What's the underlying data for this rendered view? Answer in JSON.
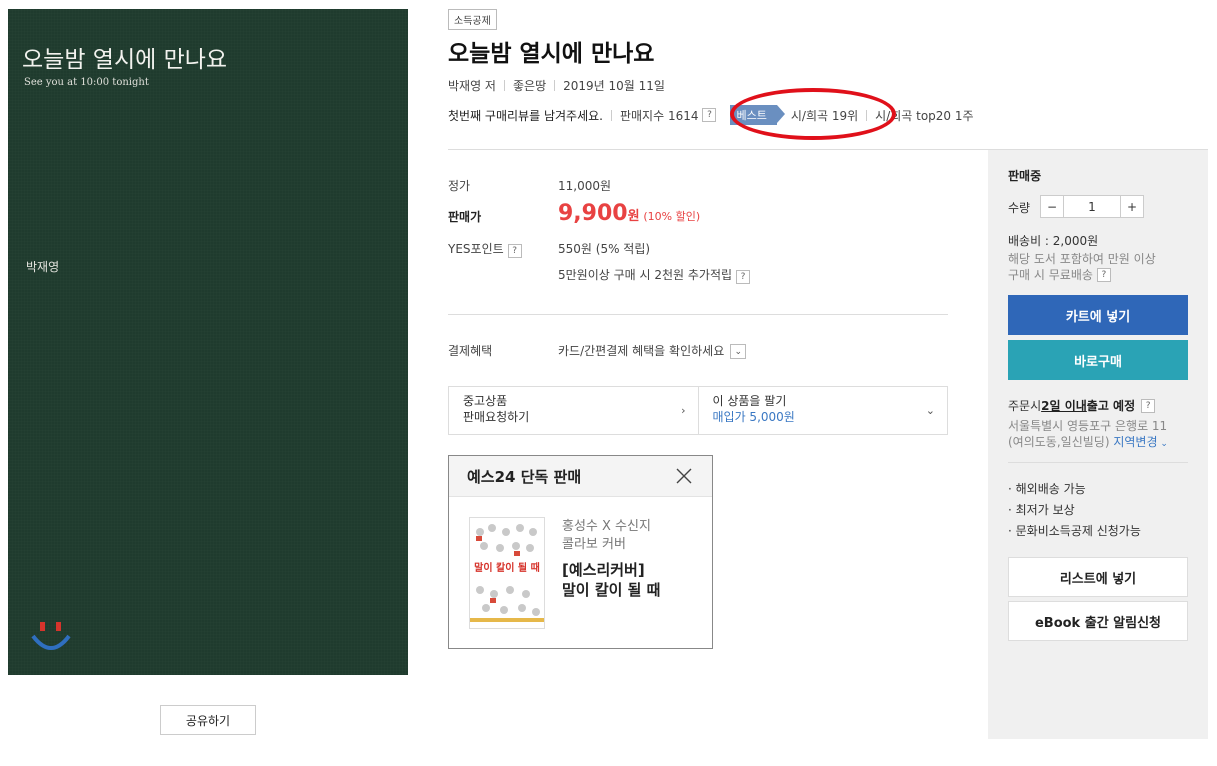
{
  "cover": {
    "title": "오늘밤 열시에 만나요",
    "subtitle": "See you at 10:00 tonight",
    "author": "박재영"
  },
  "share_label": "공유하기",
  "product": {
    "tag": "소득공제",
    "title": "오늘밤 열시에 만나요",
    "author": "박재영 저",
    "publisher": "좋은땅",
    "date": "2019년 10월 11일",
    "review_prompt": "첫번째 구매리뷰를 남겨주세요.",
    "sales_index": "판매지수 1614",
    "best_label": "베스트",
    "rank1": "시/희곡 19위",
    "rank2": "시/희곡 top20 1주"
  },
  "price": {
    "list_label": "정가",
    "list_value": "11,000원",
    "sale_label": "판매가",
    "sale_amount": "9,900",
    "sale_unit": "원",
    "discount": "(10% 할인)",
    "points_label": "YES포인트",
    "points_value": "550원 (5% 적립)",
    "points_extra": "5만원이상 구매 시 2천원 추가적립",
    "payment_label": "결제혜택",
    "payment_value": "카드/간편결제 혜택을 확인하세요"
  },
  "used": {
    "left_line1": "중고상품",
    "left_line2": "판매요청하기",
    "right_line1": "이 상품을 팔기",
    "right_line2": "매입가 5,000원"
  },
  "exclusive": {
    "heading": "예스24 단독 판매",
    "sub1": "홍성수 X 수신지",
    "sub2": "콜라보 커버",
    "name1": "[예스리커버]",
    "name2": "말이 칼이 될 때",
    "thumb_title": "말이 칼이 될 때"
  },
  "sidebar": {
    "status": "판매중",
    "qty_label": "수량",
    "qty_value": "1",
    "minus": "−",
    "plus": "+",
    "shipping": "배송비 : 2,000원",
    "free_ship1": "해당 도서 포함하여 만원 이상",
    "free_ship2": "구매 시 무료배송",
    "cart_label": "카트에 넣기",
    "buy_label": "바로구매",
    "order_prefix": "주문시 ",
    "order_days": "2일 이내",
    "order_suffix": " 출고 예정",
    "address1": "서울특별시 영등포구 은행로 11",
    "address2": "(여의도동,일신빌딩)",
    "region_change": "지역변경",
    "feature1": "· 해외배송 가능",
    "feature2": "· 최저가 보상",
    "feature3": "· 문화비소득공제 신청가능",
    "list_label": "리스트에 넣기",
    "ebook_label": "eBook 출간 알림신청"
  },
  "colors": {
    "cover_bg": "#1f3b2e",
    "price_red": "#e84242",
    "cart_blue": "#2f67b8",
    "buy_teal": "#2aa3b5",
    "annotation_red": "#e0101a"
  }
}
